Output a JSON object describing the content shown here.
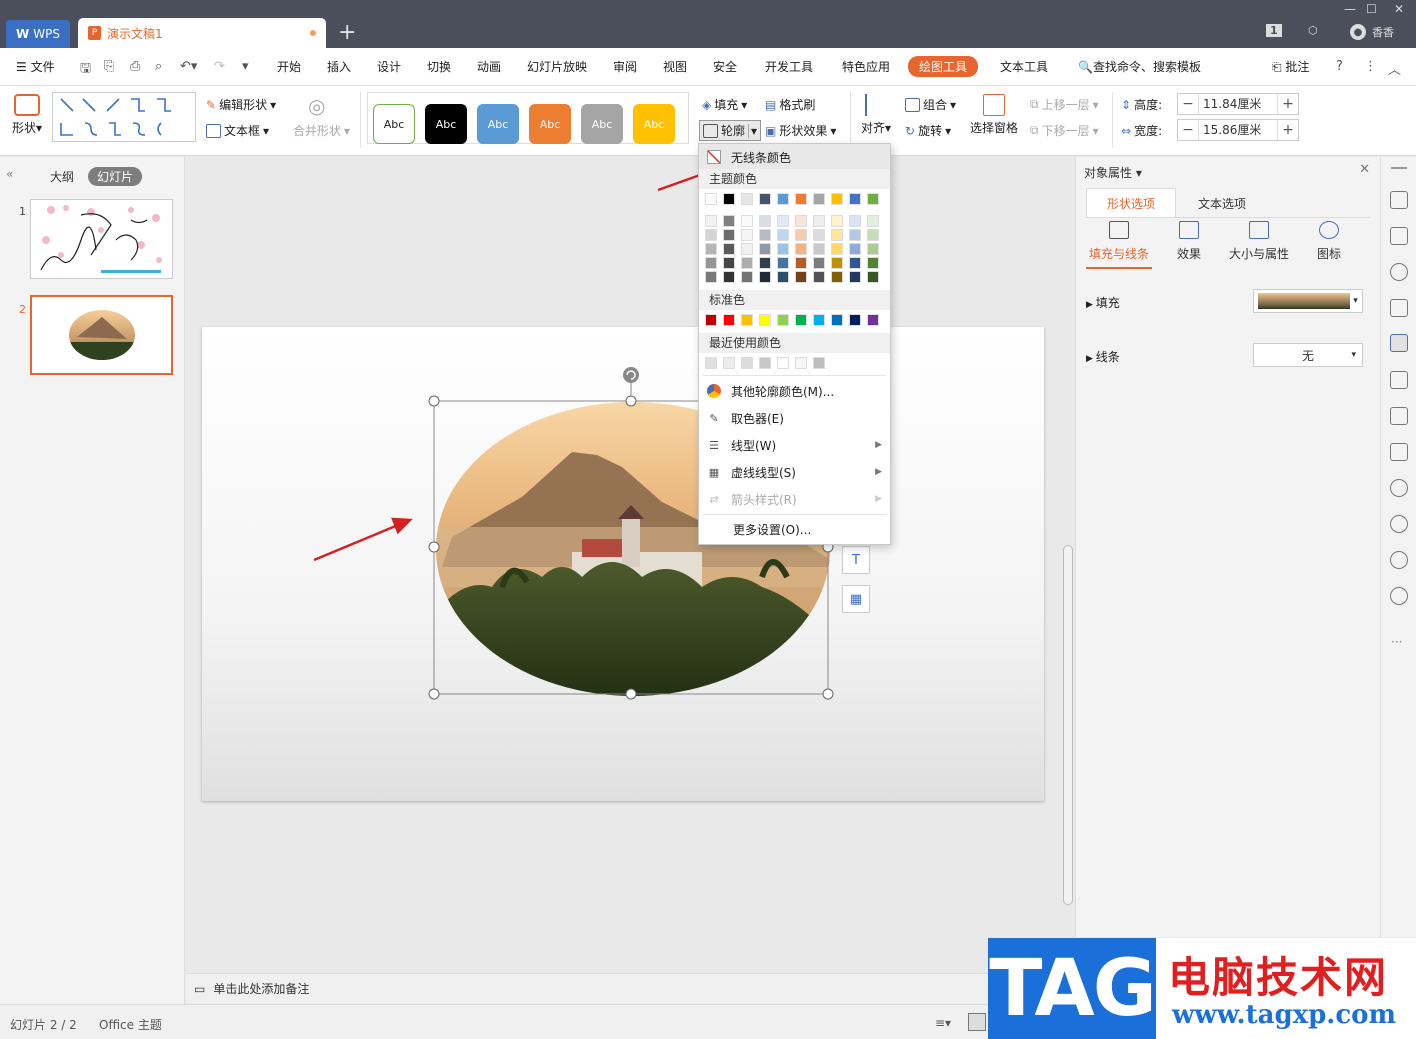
{
  "titlebar": {
    "app_tab": "WPS",
    "doc_tab": "演示文稿1",
    "new_tab": "+",
    "user_name": "香香",
    "badge": "1"
  },
  "menubar": {
    "file": "文件",
    "items": [
      "开始",
      "插入",
      "设计",
      "切换",
      "动画",
      "幻灯片放映",
      "审阅",
      "视图",
      "安全",
      "开发工具",
      "特色应用",
      "绘图工具",
      "文本工具"
    ],
    "active": "绘图工具",
    "search": "查找命令、搜索模板",
    "comment": "批注"
  },
  "ribbon": {
    "shape": "形状",
    "edit_shape": "编辑形状",
    "text_box": "文本框",
    "merge_shape": "合并形状",
    "style_label": "Abc",
    "fill": "填充",
    "format_painter": "格式刷",
    "outline": "轮廓",
    "shape_effect": "形状效果",
    "align": "对齐",
    "group": "组合",
    "rotate": "旋转",
    "selection_pane": "选择窗格",
    "bring_forward": "上移一层",
    "send_backward": "下移一层",
    "height_label": "高度:",
    "height_value": "11.84厘米",
    "width_label": "宽度:",
    "width_value": "15.86厘米",
    "style_colors": [
      "#ffffff",
      "#000000",
      "#5b9bd5",
      "#ed7d31",
      "#a5a5a5",
      "#ffc000"
    ]
  },
  "leftpanel": {
    "outline_tab": "大纲",
    "slides_tab": "幻灯片",
    "slide_numbers": [
      "1",
      "2"
    ]
  },
  "notes": {
    "placeholder": "单击此处添加备注"
  },
  "statusbar": {
    "slide_info": "幻灯片 2 / 2",
    "theme": "Office 主题"
  },
  "rightpanel": {
    "title": "对象属性",
    "tab_shape": "形状选项",
    "tab_text": "文本选项",
    "sub_fill_line": "填充与线条",
    "sub_effect": "效果",
    "sub_size": "大小与属性",
    "sub_icon": "图标",
    "fill_label": "填充",
    "line_label": "线条",
    "line_value": "无"
  },
  "outline_menu": {
    "no_line": "无线条颜色",
    "theme_colors": "主题颜色",
    "standard_colors": "标准色",
    "recent_colors": "最近使用颜色",
    "more_colors": "其他轮廓颜色(M)...",
    "eyedropper": "取色器(E)",
    "line_style": "线型(W)",
    "dash_style": "虚线线型(S)",
    "arrow_style": "箭头样式(R)",
    "more_settings": "更多设置(O)...",
    "theme_row": [
      "#ffffff",
      "#000000",
      "#e7e6e6",
      "#44546a",
      "#5b9bd5",
      "#ed7d31",
      "#a5a5a5",
      "#ffc000",
      "#4472c4",
      "#70ad47"
    ],
    "standard_row": [
      "#c00000",
      "#ff0000",
      "#ffc000",
      "#ffff00",
      "#92d050",
      "#00b050",
      "#00b0f0",
      "#0070c0",
      "#002060",
      "#7030a0"
    ],
    "recent_row": [
      "#e0e0e0",
      "#ececec",
      "#dcdcdc",
      "#c8c8c8",
      "#ffffff",
      "#f5f5f5",
      "#bdbdbd"
    ]
  },
  "watermark": {
    "logo": "TAG",
    "title": "电脑技术网",
    "url": "www.tagxp.com"
  },
  "colors": {
    "accent": "#e8652f",
    "titlebar": "#4b4f5c",
    "arrow": "#d42020"
  }
}
